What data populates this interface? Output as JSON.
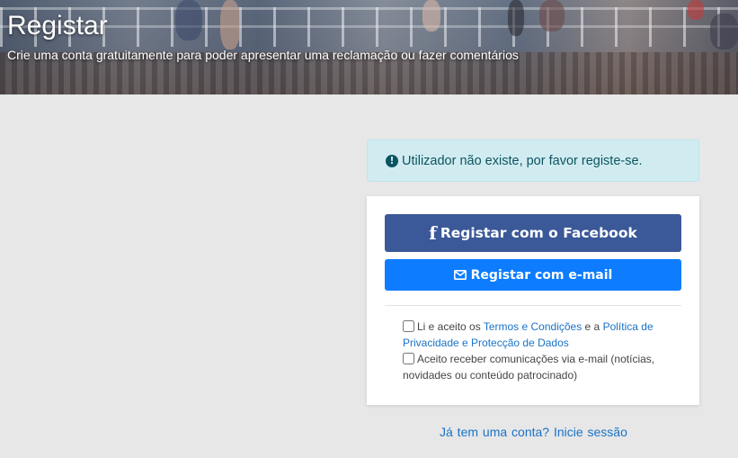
{
  "header": {
    "title": "Registar",
    "subtitle": "Crie uma conta gratuitamente para poder apresentar uma reclamação ou fazer comentários"
  },
  "alert": {
    "icon": "exclamation-circle-icon",
    "text": "Utilizador não existe, por favor registe-se.",
    "color": "#0c5460",
    "background": "#d1ecf1"
  },
  "buttons": {
    "facebook": {
      "icon": "facebook-icon",
      "label": "Registar com o Facebook",
      "color": "#3b5998"
    },
    "email": {
      "icon": "envelope-icon",
      "label": "Registar com e-mail",
      "color": "#0d7cff"
    }
  },
  "consent": {
    "terms_prefix": "Li e aceito os ",
    "terms_link": "Termos e Condições",
    "terms_middle": " e a ",
    "privacy_link": "Política de Privacidade e Protecção de Dados",
    "terms_checked": false,
    "marketing_label": "Aceito receber comunicações via e-mail (notícias, novidades ou conteúdo patrocinado)",
    "marketing_checked": false
  },
  "footer": {
    "question": "Já tem uma conta?",
    "login_link": "Inicie sessão"
  }
}
